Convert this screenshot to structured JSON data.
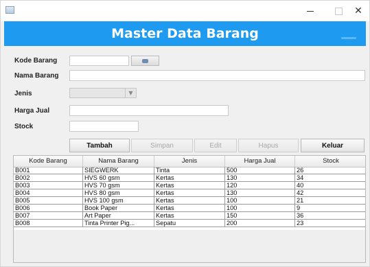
{
  "window": {
    "title": "",
    "controls": {
      "minimize": "—",
      "maximize": "",
      "close": "✕"
    }
  },
  "banner": {
    "title": "Master Data Barang",
    "color": "#1e9bf0"
  },
  "form": {
    "kode_label": "Kode Barang",
    "kode_value": "",
    "nama_label": "Nama Barang",
    "nama_value": "",
    "jenis_label": "Jenis",
    "jenis_value": "",
    "harga_label": "Harga Jual",
    "harga_value": "",
    "stock_label": "Stock",
    "stock_value": ""
  },
  "buttons": {
    "tambah": "Tambah",
    "simpan": "Simpan",
    "edit": "Edit",
    "hapus": "Hapus",
    "keluar": "Keluar"
  },
  "table": {
    "headers": [
      "Kode Barang",
      "Nama Barang",
      "Jenis",
      "Harga Jual",
      "Stock"
    ],
    "rows": [
      [
        "B001",
        "SIEGWERK",
        "Tinta",
        "500",
        "26"
      ],
      [
        "B002",
        "HVS 60 gsm",
        "Kertas",
        "130",
        "34"
      ],
      [
        "B003",
        "HVS 70 gsm",
        "Kertas",
        "120",
        "40"
      ],
      [
        "B004",
        "HVS 80 gsm",
        "Kertas",
        "130",
        "42"
      ],
      [
        "B005",
        "HVS 100 gsm",
        "Kertas",
        "100",
        "21"
      ],
      [
        "B006",
        "Book Paper",
        "Kertas",
        "100",
        "9"
      ],
      [
        "B007",
        "Art Paper",
        "Kertas",
        "150",
        "36"
      ],
      [
        "B008",
        "Tinta Printer Pig...",
        "Sepatu",
        "200",
        "23"
      ]
    ]
  }
}
